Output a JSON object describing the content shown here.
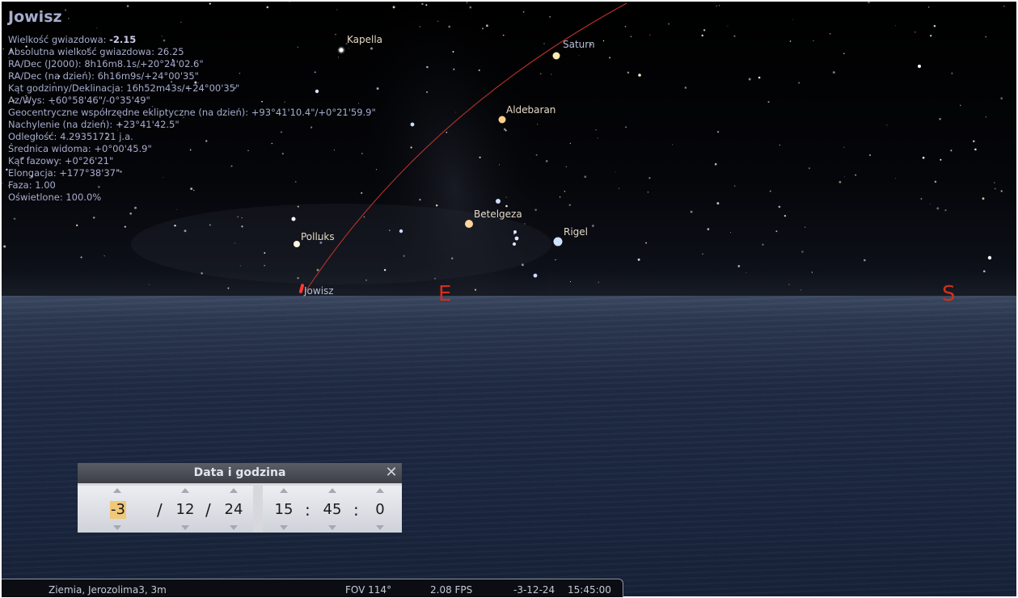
{
  "object_info": {
    "name": "Jowisz",
    "rows": [
      {
        "label": "Wielkość gwiazdowa: ",
        "value": "-2.15",
        "bold": true
      },
      {
        "label": "Absolutna wielkość gwiazdowa: ",
        "value": "26.25"
      },
      {
        "label": "RA/Dec (J2000): ",
        "value": "8h16m8.1s/+20°24'02.6\""
      },
      {
        "label": "RA/Dec (na dzień): ",
        "value": "6h16m9s/+24°00'35\""
      },
      {
        "label": "Kąt godzinny/Deklinacja: ",
        "value": "16h52m43s/+24°00'35\""
      },
      {
        "label": "Az/Wys: ",
        "value": "+60°58'46\"/-0°35'49\""
      },
      {
        "label": "Geocentryczne współrzędne ekliptyczne (na dzień): ",
        "value": "+93°41'10.4\"/+0°21'59.9\""
      },
      {
        "label": "Nachylenie (na dzień): ",
        "value": "+23°41'42.5\""
      },
      {
        "label": "Odległość: ",
        "value": "4.29351721 j.a."
      },
      {
        "label": "Średnica widoma: ",
        "value": "+0°00'45.9\""
      },
      {
        "label": "Kąt fazowy: ",
        "value": "+0°26'21\""
      },
      {
        "label": "Elongacja: ",
        "value": "+177°38'37\""
      },
      {
        "label": "Faza: ",
        "value": "1.00"
      },
      {
        "label": "Oświetlone: ",
        "value": "100.0%"
      }
    ]
  },
  "sky_labels": {
    "kapella": "Kapella",
    "saturn": "Saturn",
    "aldebaran": "Aldebaran",
    "betelgeza": "Betelgeza",
    "rigel": "Rigel",
    "polluks": "Polluks",
    "jowisz": "Jowisz"
  },
  "compass": {
    "east": "E",
    "south": "S"
  },
  "colors": {
    "compass": "#d42e1a",
    "ecliptic": "#c8342a",
    "info_text": "#a7adcc"
  },
  "date_dialog": {
    "title": "Data i godzina",
    "close_icon": "close-icon",
    "year": "-3",
    "month": "12",
    "day": "24",
    "date_separator": "/",
    "hour": "15",
    "minute": "45",
    "second": "0",
    "time_separator": ":"
  },
  "status_bar": {
    "location": "Ziemia, Jerozolima3, 3m",
    "fov": "FOV 114°",
    "fps": "2.08 FPS",
    "date": "-3-12-24",
    "time": "15:45:00"
  }
}
